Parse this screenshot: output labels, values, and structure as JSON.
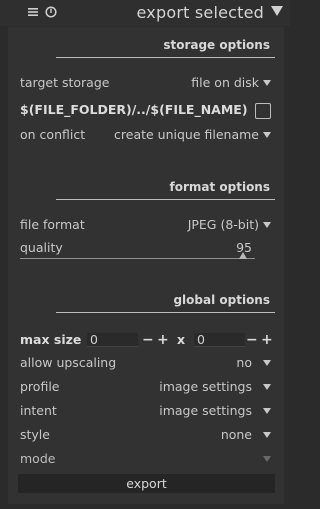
{
  "header": {
    "title": "export selected"
  },
  "storage": {
    "section_title": "storage options",
    "target_label": "target storage",
    "target_value": "file on disk",
    "path_value": "$(FILE_FOLDER)/../$(FILE_NAME)",
    "conflict_label": "on conflict",
    "conflict_value": "create unique filename"
  },
  "format": {
    "section_title": "format options",
    "file_format_label": "file format",
    "file_format_value": "JPEG (8-bit)",
    "quality_label": "quality",
    "quality_value": "95",
    "quality_fraction": 0.95
  },
  "global": {
    "section_title": "global options",
    "max_size_label": "max size",
    "width_value": "0",
    "height_value": "0",
    "minus": "−",
    "plus": "+",
    "times": "x",
    "upscaling_label": "allow upscaling",
    "upscaling_value": "no",
    "profile_label": "profile",
    "profile_value": "image settings",
    "intent_label": "intent",
    "intent_value": "image settings",
    "style_label": "style",
    "style_value": "none",
    "mode_label": "mode"
  },
  "export_button": "export"
}
